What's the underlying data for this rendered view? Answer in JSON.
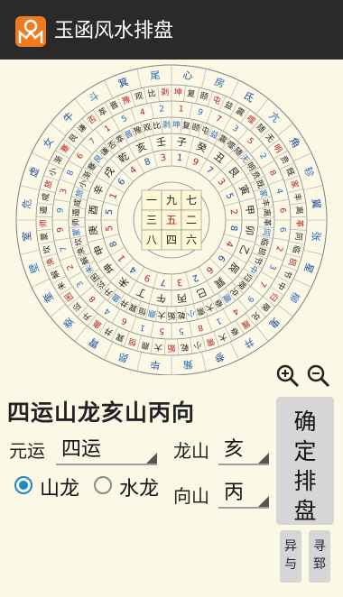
{
  "app": {
    "title": "玉函风水排盘",
    "icon": "yuhan-logo-icon"
  },
  "chart": {
    "heading": "四运山龙亥山丙向",
    "center_cells": [
      "一",
      "九",
      "七",
      "三",
      "五",
      "二",
      "八",
      "四",
      "六"
    ],
    "sitting_mountain": "亥",
    "facing_mountain": "丙"
  },
  "compass": {
    "star_ring": [
      "心",
      "房",
      "氐",
      "亢",
      "角",
      "轸",
      "翼",
      "张",
      "星",
      "柳",
      "鬼",
      "井",
      "参",
      "觜",
      "毕",
      "昴",
      "胃",
      "娄",
      "奎",
      "壁",
      "室",
      "危",
      "虚",
      "女",
      "牛",
      "斗",
      "箕",
      "尾"
    ],
    "mountain_ring": [
      "子",
      "癸",
      "丑",
      "艮",
      "寅",
      "甲",
      "卯",
      "乙",
      "辰",
      "巽",
      "巳",
      "丙",
      "午",
      "丁",
      "未",
      "坤",
      "申",
      "庚",
      "酉",
      "辛",
      "戌",
      "乾",
      "亥",
      "壬"
    ],
    "hexagram_ring": [
      "坤",
      "复",
      "颐",
      "屯",
      "益",
      "震",
      "噬",
      "随",
      "无",
      "明",
      "贲",
      "既",
      "家",
      "丰",
      "离",
      "革",
      "同",
      "临",
      "损",
      "节",
      "中",
      "归",
      "睽",
      "兑",
      "履",
      "泰",
      "大",
      "需",
      "小",
      "乾",
      "姤",
      "大",
      "鼎",
      "恒",
      "巽",
      "井",
      "蛊",
      "升",
      "讼",
      "困",
      "未",
      "解",
      "涣",
      "坎",
      "蒙",
      "师",
      "遁",
      "咸",
      "旅",
      "小",
      "渐",
      "蹇",
      "艮",
      "谦",
      "否",
      "萃",
      "晋",
      "豫",
      "观",
      "比",
      "剥"
    ],
    "number_ring": [
      "1",
      "9",
      "7",
      "3",
      "5",
      "2",
      "8",
      "4",
      "6",
      "6",
      "2",
      "3",
      "7",
      "9",
      "4",
      "1",
      "8",
      "5",
      "5",
      "1",
      "6",
      "4",
      "8",
      "3",
      "2",
      "7",
      "9",
      "9",
      "3",
      "8",
      "6",
      "7",
      "1",
      "5",
      "4",
      "2"
    ]
  },
  "zoom": {
    "in_icon": "zoom-in-icon",
    "out_icon": "zoom-out-icon"
  },
  "form": {
    "yuan_label": "元运",
    "yuan_value": "四运",
    "long_label": "龙山",
    "long_value": "亥",
    "xiang_label": "向山",
    "xiang_value": "丙",
    "radio_mountain": "山龙",
    "radio_water": "水龙",
    "mountain_selected": true
  },
  "buttons": {
    "confirm_chars": [
      "确",
      "定",
      "排",
      "盘"
    ],
    "small_left": [
      "异",
      "与"
    ],
    "small_right": [
      "寻",
      "郅"
    ]
  }
}
